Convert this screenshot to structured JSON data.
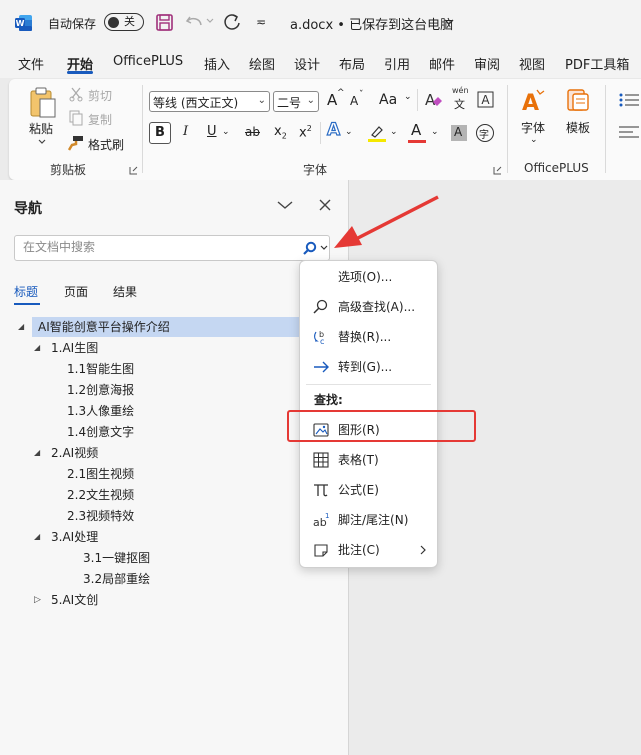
{
  "titlebar": {
    "autosave_label": "自动保存",
    "toggle_state": "关",
    "doc_title": "a.docx • 已保存到这台电脑",
    "customize_symbol": "≂"
  },
  "menu": {
    "items": [
      "文件",
      "开始",
      "OfficePLUS",
      "插入",
      "绘图",
      "设计",
      "布局",
      "引用",
      "邮件",
      "审阅",
      "视图",
      "PDF工具箱"
    ],
    "active": "开始"
  },
  "ribbon": {
    "clipboard": {
      "paste": "粘贴",
      "cut": "剪切",
      "copy": "复制",
      "format_painter": "格式刷",
      "group_label": "剪贴板"
    },
    "font": {
      "font_name": "等线 (西文正文)",
      "font_size": "二号",
      "grow": "A",
      "shrink": "A",
      "change_case": "Aa",
      "phonetic": "wén",
      "phonetic_char": "文",
      "bold": "B",
      "italic": "I",
      "underline": "U",
      "strike": "ab",
      "subscript": "x",
      "superscript": "x",
      "text_effect": "A",
      "font_color": "A",
      "shading": "A",
      "enclose": "字",
      "group_label": "字体"
    },
    "officeplus": {
      "font_btn": "字体",
      "template_btn": "模板",
      "group_label": "OfficePLUS"
    }
  },
  "nav": {
    "title": "导航",
    "search_placeholder": "在文档中搜索",
    "tabs": [
      "标题",
      "页面",
      "结果"
    ],
    "active_tab": "标题",
    "tree": [
      {
        "label": "AI智能创意平台操作介绍",
        "level": 0,
        "expanded": true,
        "selected": true
      },
      {
        "label": "1.AI生图",
        "level": 1,
        "expanded": true
      },
      {
        "label": "1.1智能生图",
        "level": 2
      },
      {
        "label": "1.2创意海报",
        "level": 2
      },
      {
        "label": "1.3人像重绘",
        "level": 2
      },
      {
        "label": "1.4创意文字",
        "level": 2
      },
      {
        "label": "2.AI视频",
        "level": 1,
        "expanded": true
      },
      {
        "label": "2.1图生视频",
        "level": 2
      },
      {
        "label": "2.2文生视频",
        "level": 2
      },
      {
        "label": "2.3视频特效",
        "level": 2
      },
      {
        "label": "3.AI处理",
        "level": 1,
        "expanded": true
      },
      {
        "label": "3.1一键抠图",
        "level": 3
      },
      {
        "label": "3.2局部重绘",
        "level": 3
      },
      {
        "label": "5.AI文创",
        "level": 1,
        "expanded": false
      }
    ]
  },
  "context_menu": {
    "items_top": [
      {
        "label": "选项(O)...",
        "icon": "none"
      },
      {
        "label": "高级查找(A)...",
        "icon": "search-icon"
      },
      {
        "label": "替换(R)...",
        "icon": "replace-icon"
      },
      {
        "label": "转到(G)...",
        "icon": "arrow-right-icon"
      }
    ],
    "section_header": "查找:",
    "items_find": [
      {
        "label": "图形(R)",
        "icon": "graphics-icon",
        "highlighted": true
      },
      {
        "label": "表格(T)",
        "icon": "table-icon"
      },
      {
        "label": "公式(E)",
        "icon": "pi-icon"
      },
      {
        "label": "脚注/尾注(N)",
        "icon": "footnote-icon"
      },
      {
        "label": "批注(C)",
        "icon": "comment-icon",
        "submenu": true
      }
    ]
  },
  "colors": {
    "accent": "#185abd",
    "word_blue": "#185abd",
    "annotation_red": "#e53935",
    "font_color_red": "#e53935",
    "highlight_yellow": "#f5e800",
    "selected_row": "#c5d7f2"
  }
}
